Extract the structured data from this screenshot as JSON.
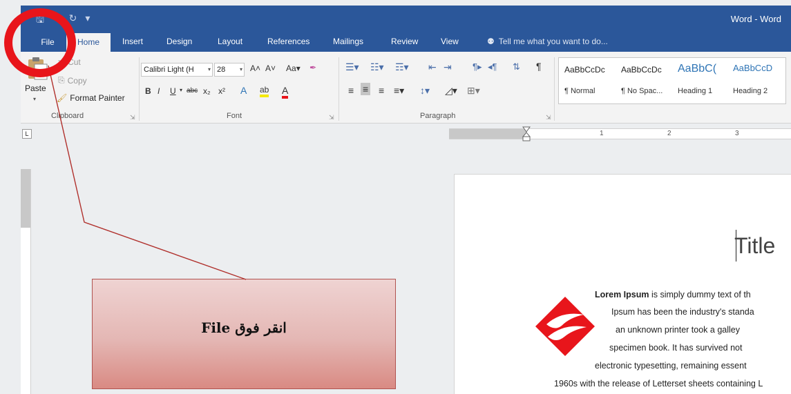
{
  "window": {
    "title": "Word - Word"
  },
  "tabs": [
    "File",
    "Home",
    "Insert",
    "Design",
    "Layout",
    "References",
    "Mailings",
    "Review",
    "View"
  ],
  "tell_me": {
    "placeholder": "Tell me what you want to do..."
  },
  "clipboard": {
    "paste": "Paste",
    "cut": "Cut",
    "copy": "Copy",
    "format_painter": "Format Painter",
    "group_label": "Clipboard"
  },
  "font": {
    "name": "Calibri Light (H",
    "size": "28",
    "group_label": "Font",
    "change_case": "Aa"
  },
  "paragraph": {
    "group_label": "Paragraph"
  },
  "styles": [
    {
      "preview": "AaBbCcDc",
      "name": "¶ Normal"
    },
    {
      "preview": "AaBbCcDc",
      "name": "¶ No Spac..."
    },
    {
      "preview": "AaBbC(",
      "name": "Heading 1"
    },
    {
      "preview": "AaBbCcD",
      "name": "Heading 2"
    }
  ],
  "ruler": {
    "marks": [
      "1",
      "2",
      "3"
    ]
  },
  "document": {
    "title": "Title",
    "lines": [
      {
        "bold": "Lorem Ipsum",
        "text": " is simply dummy text of th"
      },
      {
        "text": "Ipsum has been the industry's standa"
      },
      {
        "text": "an unknown printer took a galley"
      },
      {
        "text": "specimen book. It has survived not"
      },
      {
        "text": "electronic typesetting, remaining essent"
      },
      {
        "text": "1960s with the release of Letterset sheets containing L"
      }
    ]
  },
  "callout": {
    "text": "انقر فوق File"
  },
  "colors": {
    "ribbon_blue": "#2b579a",
    "highlight_red": "#e8151b",
    "callout_fill": "#e4b7b4"
  }
}
